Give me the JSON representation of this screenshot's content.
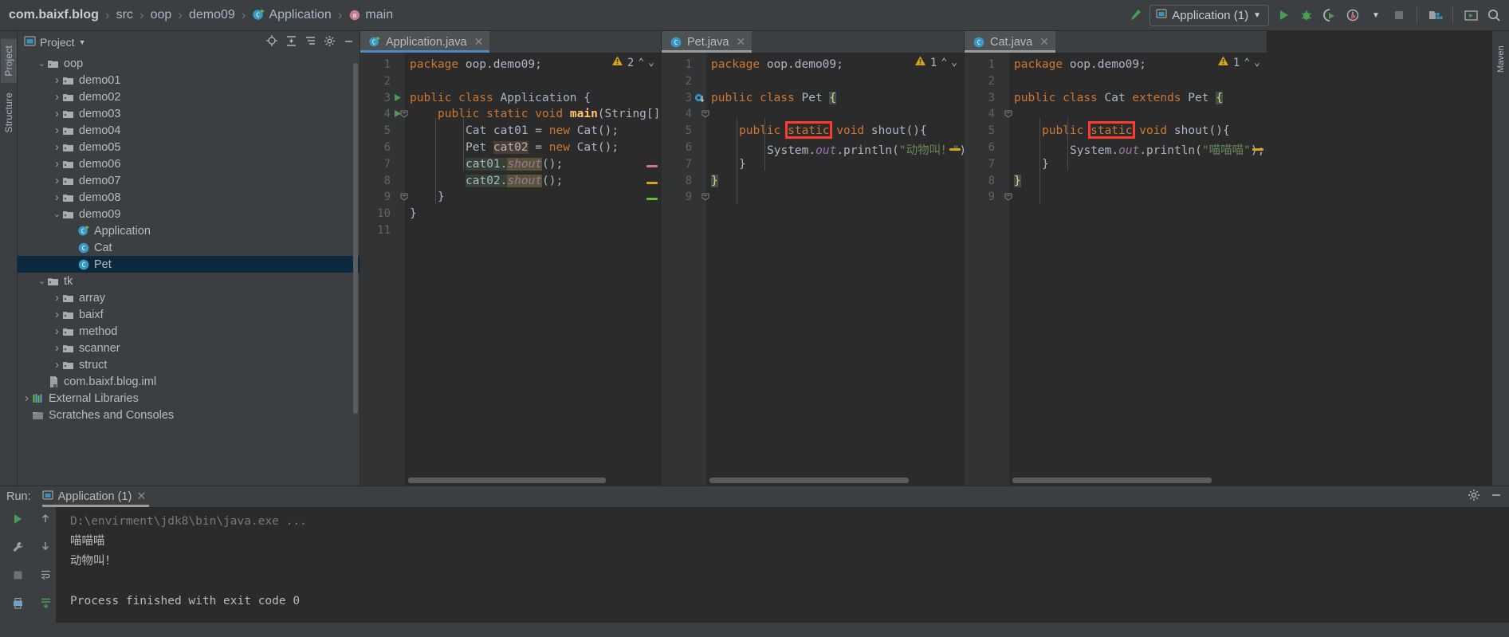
{
  "breadcrumb": {
    "items": [
      {
        "label": "com.baixf.blog",
        "icon": "none",
        "bold": true
      },
      {
        "label": "src",
        "icon": "none",
        "bold": false
      },
      {
        "label": "oop",
        "icon": "none",
        "bold": false
      },
      {
        "label": "demo09",
        "icon": "none",
        "bold": false
      },
      {
        "label": "Application",
        "icon": "class-runnable-icon",
        "bold": false
      },
      {
        "label": "main",
        "icon": "method-icon",
        "bold": false
      }
    ]
  },
  "toolbar": {
    "build_icon": "hammer-icon",
    "run_config": "Application (1)",
    "run_config_icon": "application-config-icon",
    "dropdown_icon": "chevron-down-icon",
    "run_icon": "run-icon",
    "debug_icon": "debug-icon",
    "run_coverage_icon": "run-with-coverage-icon",
    "profiler_icon": "profiler-icon",
    "stop_icon": "stop-icon",
    "build_project_icon": "build-project-icon",
    "preview_icon": "preview-icon",
    "search_icon": "search-icon"
  },
  "project_panel": {
    "title": "Project",
    "dropdown_icon": "chevron-down-icon",
    "actions": [
      "locate-icon",
      "expand-all-icon",
      "collapse-all-icon",
      "settings-icon",
      "minimize-icon"
    ],
    "vertical_tabs": [
      "Project",
      "Structure"
    ],
    "tree": [
      {
        "label": "oop",
        "depth": 2,
        "twist": "down",
        "icon": "folder-icon",
        "selected": false
      },
      {
        "label": "demo01",
        "depth": 3,
        "twist": "right",
        "icon": "folder-icon",
        "selected": false
      },
      {
        "label": "demo02",
        "depth": 3,
        "twist": "right",
        "icon": "folder-icon",
        "selected": false
      },
      {
        "label": "demo03",
        "depth": 3,
        "twist": "right",
        "icon": "folder-icon",
        "selected": false
      },
      {
        "label": "demo04",
        "depth": 3,
        "twist": "right",
        "icon": "folder-icon",
        "selected": false
      },
      {
        "label": "demo05",
        "depth": 3,
        "twist": "right",
        "icon": "folder-icon",
        "selected": false
      },
      {
        "label": "demo06",
        "depth": 3,
        "twist": "right",
        "icon": "folder-icon",
        "selected": false
      },
      {
        "label": "demo07",
        "depth": 3,
        "twist": "right",
        "icon": "folder-icon",
        "selected": false
      },
      {
        "label": "demo08",
        "depth": 3,
        "twist": "right",
        "icon": "folder-icon",
        "selected": false
      },
      {
        "label": "demo09",
        "depth": 3,
        "twist": "down",
        "icon": "folder-icon",
        "selected": false
      },
      {
        "label": "Application",
        "depth": 4,
        "twist": "none",
        "icon": "class-runnable-icon",
        "selected": false
      },
      {
        "label": "Cat",
        "depth": 4,
        "twist": "none",
        "icon": "class-icon",
        "selected": false
      },
      {
        "label": "Pet",
        "depth": 4,
        "twist": "none",
        "icon": "class-icon",
        "selected": true
      },
      {
        "label": "tk",
        "depth": 2,
        "twist": "down",
        "icon": "folder-icon",
        "selected": false
      },
      {
        "label": "array",
        "depth": 3,
        "twist": "right",
        "icon": "folder-icon",
        "selected": false
      },
      {
        "label": "baixf",
        "depth": 3,
        "twist": "right",
        "icon": "folder-icon",
        "selected": false
      },
      {
        "label": "method",
        "depth": 3,
        "twist": "right",
        "icon": "folder-icon",
        "selected": false
      },
      {
        "label": "scanner",
        "depth": 3,
        "twist": "right",
        "icon": "folder-icon",
        "selected": false
      },
      {
        "label": "struct",
        "depth": 3,
        "twist": "right",
        "icon": "folder-icon",
        "selected": false
      },
      {
        "label": "com.baixf.blog.iml",
        "depth": 2,
        "twist": "none",
        "icon": "iml-file-icon",
        "selected": false
      },
      {
        "label": "External Libraries",
        "depth": 1,
        "twist": "right",
        "icon": "libraries-icon",
        "selected": false
      },
      {
        "label": "Scratches and Consoles",
        "depth": 1,
        "twist": "none",
        "icon": "scratches-icon",
        "selected": false
      }
    ]
  },
  "editors": [
    {
      "tab_label": "Application.java",
      "tab_icon": "class-runnable-icon",
      "close_icon": "close-icon",
      "active": true,
      "warning_count": "2",
      "warning_icon": "warning-triangle-icon",
      "up_icon": "chevron-up-icon",
      "down_icon": "chevron-down-icon",
      "lines": [
        {
          "n": "1",
          "segments": [
            {
              "t": "package",
              "c": "kw"
            },
            {
              "t": " oop.demo09;",
              "c": "pl"
            }
          ]
        },
        {
          "n": "2",
          "segments": []
        },
        {
          "n": "3",
          "segments": [
            {
              "t": "public ",
              "c": "kw"
            },
            {
              "t": "class ",
              "c": "kw"
            },
            {
              "t": "Application ",
              "c": "cls"
            },
            {
              "t": "{",
              "c": "pl"
            }
          ],
          "gutter": "run"
        },
        {
          "n": "4",
          "segments": [
            {
              "t": "public ",
              "c": "kw"
            },
            {
              "t": "static ",
              "c": "kw"
            },
            {
              "t": "void ",
              "c": "kw"
            },
            {
              "t": "main",
              "c": "mainkw"
            },
            {
              "t": "(String[] args)",
              "c": "pl"
            }
          ],
          "gutter": "run",
          "indent": 1
        },
        {
          "n": "5",
          "segments": [
            {
              "t": "Cat cat01 = ",
              "c": "pl"
            },
            {
              "t": "new ",
              "c": "kw"
            },
            {
              "t": "Cat();",
              "c": "pl"
            }
          ],
          "indent": 2
        },
        {
          "n": "6",
          "segments": [
            {
              "t": "Pet ",
              "c": "pl"
            },
            {
              "t": "cat02",
              "c": "pl",
              "hl": "brown"
            },
            {
              "t": " = ",
              "c": "pl"
            },
            {
              "t": "new ",
              "c": "kw"
            },
            {
              "t": "Cat();",
              "c": "pl"
            }
          ],
          "indent": 2
        },
        {
          "n": "7",
          "segments": [
            {
              "t": "cat01.",
              "c": "pl",
              "hl": "green"
            },
            {
              "t": "shout",
              "c": "fld",
              "hl": "yellow"
            },
            {
              "t": "();",
              "c": "pl"
            }
          ],
          "indent": 2
        },
        {
          "n": "8",
          "segments": [
            {
              "t": "cat02.",
              "c": "pl",
              "hl": "green"
            },
            {
              "t": "shout",
              "c": "fld",
              "hl": "yellow"
            },
            {
              "t": "();",
              "c": "pl"
            }
          ],
          "indent": 2
        },
        {
          "n": "9",
          "segments": [
            {
              "t": "}",
              "c": "pl"
            }
          ],
          "indent": 1
        },
        {
          "n": "10",
          "segments": [
            {
              "t": "}",
              "c": "pl"
            }
          ]
        },
        {
          "n": "11",
          "segments": []
        }
      ]
    },
    {
      "tab_label": "Pet.java",
      "tab_icon": "class-icon",
      "close_icon": "close-icon",
      "active": false,
      "warning_count": "1",
      "warning_icon": "warning-triangle-icon",
      "up_icon": "chevron-up-icon",
      "down_icon": "chevron-down-icon",
      "lines": [
        {
          "n": "1",
          "segments": [
            {
              "t": "package",
              "c": "kw"
            },
            {
              "t": " oop.demo09;",
              "c": "pl"
            }
          ]
        },
        {
          "n": "2",
          "segments": []
        },
        {
          "n": "3",
          "segments": [
            {
              "t": "public ",
              "c": "kw"
            },
            {
              "t": "class ",
              "c": "kw"
            },
            {
              "t": "Pet ",
              "c": "cls"
            },
            {
              "t": "{",
              "c": "pl",
              "hl": "brace"
            }
          ],
          "gutter": "override"
        },
        {
          "n": "4",
          "segments": []
        },
        {
          "n": "5",
          "segments": [
            {
              "t": "public ",
              "c": "kw"
            },
            {
              "t": "static",
              "c": "kw",
              "box": true
            },
            {
              "t": " void ",
              "c": "kw"
            },
            {
              "t": "shout",
              "c": "cls"
            },
            {
              "t": "(){",
              "c": "pl"
            }
          ],
          "indent": 1
        },
        {
          "n": "6",
          "segments": [
            {
              "t": "System.",
              "c": "pl"
            },
            {
              "t": "out",
              "c": "fld"
            },
            {
              "t": ".println(",
              "c": "pl"
            },
            {
              "t": "\"动物叫！\"",
              "c": "str"
            },
            {
              "t": ");",
              "c": "pl"
            }
          ],
          "indent": 2
        },
        {
          "n": "7",
          "segments": [
            {
              "t": "}",
              "c": "pl"
            }
          ],
          "indent": 1
        },
        {
          "n": "8",
          "segments": [
            {
              "t": "}",
              "c": "pl",
              "hl": "brace"
            }
          ]
        },
        {
          "n": "9",
          "segments": []
        }
      ]
    },
    {
      "tab_label": "Cat.java",
      "tab_icon": "class-icon",
      "close_icon": "close-icon",
      "active": false,
      "warning_count": "1",
      "warning_icon": "warning-triangle-icon",
      "up_icon": "chevron-up-icon",
      "down_icon": "chevron-down-icon",
      "lines": [
        {
          "n": "1",
          "segments": [
            {
              "t": "package",
              "c": "kw"
            },
            {
              "t": " oop.demo09;",
              "c": "pl"
            }
          ]
        },
        {
          "n": "2",
          "segments": []
        },
        {
          "n": "3",
          "segments": [
            {
              "t": "public ",
              "c": "kw"
            },
            {
              "t": "class ",
              "c": "kw"
            },
            {
              "t": "Cat ",
              "c": "cls"
            },
            {
              "t": "extends ",
              "c": "kw"
            },
            {
              "t": "Pet ",
              "c": "cls"
            },
            {
              "t": "{",
              "c": "pl",
              "hl": "brace"
            }
          ]
        },
        {
          "n": "4",
          "segments": []
        },
        {
          "n": "5",
          "segments": [
            {
              "t": "public ",
              "c": "kw"
            },
            {
              "t": "static",
              "c": "kw",
              "box": true
            },
            {
              "t": " void ",
              "c": "kw"
            },
            {
              "t": "shout",
              "c": "cls"
            },
            {
              "t": "(){",
              "c": "pl"
            }
          ],
          "indent": 1
        },
        {
          "n": "6",
          "segments": [
            {
              "t": "System.",
              "c": "pl"
            },
            {
              "t": "out",
              "c": "fld"
            },
            {
              "t": ".println(",
              "c": "pl"
            },
            {
              "t": "\"喵喵喵\"",
              "c": "str"
            },
            {
              "t": ");",
              "c": "pl"
            }
          ],
          "indent": 2
        },
        {
          "n": "7",
          "segments": [
            {
              "t": "}",
              "c": "pl"
            }
          ],
          "indent": 1
        },
        {
          "n": "8",
          "segments": [
            {
              "t": "}",
              "c": "pl",
              "hl": "brace"
            }
          ]
        },
        {
          "n": "9",
          "segments": []
        }
      ]
    }
  ],
  "run_panel": {
    "label": "Run:",
    "tab_label": "Application (1)",
    "tab_icon": "application-config-icon",
    "close_icon": "close-icon",
    "settings_icon": "settings-icon",
    "minimize_icon": "minimize-icon",
    "side_actions": [
      "rerun-icon",
      "wrench-icon",
      "stop-icon",
      "print-icon"
    ],
    "side_actions2": [
      "scroll-up-icon",
      "scroll-down-icon",
      "soft-wrap-icon",
      "scroll-to-end-icon"
    ],
    "console_lines": [
      {
        "text": "D:\\envirment\\jdk8\\bin\\java.exe ...",
        "style": "dim"
      },
      {
        "text": "喵喵喵",
        "style": "normal"
      },
      {
        "text": "动物叫！",
        "style": "normal"
      },
      {
        "text": "",
        "style": "normal"
      },
      {
        "text": "Process finished with exit code 0",
        "style": "normal"
      }
    ]
  },
  "colors": {
    "accent": "#4a88c7",
    "selection": "#0d293e",
    "annotation_red": "#ff3b30",
    "editor_bg": "#2b2b2b",
    "panel_bg": "#3c3f41"
  }
}
